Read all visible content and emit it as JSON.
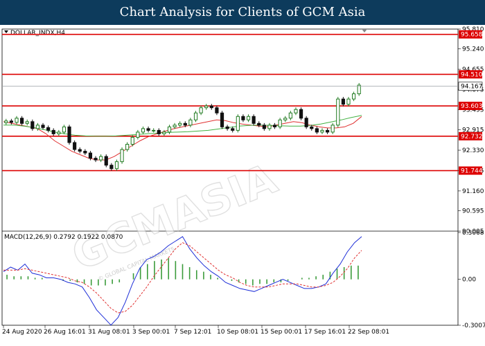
{
  "header": {
    "title": "Chart Analysis for Clients of GCM Asia"
  },
  "symbol_label": "DOLLAR_INDX,H4",
  "watermark": {
    "main": "GCMASIA",
    "sub": "© GLOBAL CAPITAL MARKETS"
  },
  "chart_data": [
    {
      "type": "candlestick",
      "title": "DOLLAR_INDX,H4",
      "ylim": [
        90.005,
        95.81
      ],
      "y_ticks": [
        95.81,
        95.24,
        94.655,
        94.075,
        93.495,
        92.915,
        92.33,
        91.745,
        91.16,
        90.595,
        90.005
      ],
      "current_price": 94.167,
      "support_resistance": [
        95.658,
        94.51,
        93.603,
        92.732,
        91.744
      ],
      "x_ticks": [
        "24 Aug 2020",
        "26 Aug 16:01",
        "31 Aug 08:01",
        "3 Sep 00:01",
        "7 Sep 12:01",
        "10 Sep 08:01",
        "15 Sep 00:01",
        "17 Sep 16:01",
        "22 Sep 08:01"
      ],
      "close_series": [
        93.17,
        93.13,
        93.25,
        93.1,
        93.15,
        92.95,
        93.05,
        92.98,
        92.9,
        92.8,
        92.85,
        93.0,
        92.55,
        92.35,
        92.3,
        92.25,
        92.1,
        92.05,
        92.15,
        91.9,
        91.8,
        92.0,
        92.35,
        92.5,
        92.7,
        92.85,
        92.95,
        92.9,
        92.9,
        92.8,
        92.85,
        93.0,
        93.05,
        93.1,
        93.05,
        93.2,
        93.4,
        93.55,
        93.6,
        93.55,
        93.4,
        93.0,
        92.95,
        92.9,
        93.3,
        93.2,
        93.3,
        93.1,
        93.05,
        92.95,
        93.05,
        93.0,
        93.2,
        93.25,
        93.4,
        93.5,
        93.25,
        93.0,
        92.95,
        92.85,
        92.9,
        92.85,
        93.05,
        93.8,
        93.65,
        93.8,
        93.95,
        94.2
      ],
      "ma_red": [
        93.15,
        93.1,
        93.05,
        93.0,
        92.95,
        92.8,
        92.6,
        92.45,
        92.3,
        92.2,
        92.1,
        92.05,
        92.05,
        92.15,
        92.3,
        92.45,
        92.6,
        92.72,
        92.8,
        92.88,
        92.95,
        93.0,
        93.05,
        93.1,
        93.15,
        93.2,
        93.18,
        93.12,
        93.08,
        93.05,
        93.02,
        93.0,
        93.05,
        93.1,
        93.15,
        93.12,
        93.05,
        93.0,
        92.97,
        92.97,
        93.0,
        93.1,
        93.3
      ],
      "ma_green": [
        93.05,
        93.05,
        93.02,
        92.98,
        92.92,
        92.85,
        92.8,
        92.76,
        92.74,
        92.73,
        92.73,
        92.74,
        92.76,
        92.78,
        92.8,
        92.82,
        92.84,
        92.85,
        92.86,
        92.88,
        92.9,
        92.94,
        92.98,
        93.02,
        93.04,
        93.05,
        93.04,
        93.03,
        93.02,
        93.02,
        93.04,
        93.08,
        93.14,
        93.2,
        93.27,
        93.33
      ]
    },
    {
      "type": "line",
      "title": "MACD(12,26,9) 0.2792 0.1922 0.0870",
      "ylim": [
        -0.3007,
        0.3068
      ],
      "y_ticks": [
        0.3068,
        0.0,
        -0.3007
      ],
      "series": [
        {
          "name": "MACD",
          "values": [
            0.05,
            0.08,
            0.06,
            0.1,
            0.04,
            0.03,
            0.01,
            0.01,
            0.0,
            -0.02,
            -0.03,
            -0.05,
            -0.12,
            -0.2,
            -0.25,
            -0.3,
            -0.25,
            -0.15,
            -0.03,
            0.07,
            0.13,
            0.15,
            0.18,
            0.22,
            0.25,
            0.28,
            0.2,
            0.14,
            0.09,
            0.05,
            0.02,
            -0.02,
            -0.04,
            -0.06,
            -0.07,
            -0.08,
            -0.06,
            -0.04,
            -0.02,
            0.0,
            -0.02,
            -0.04,
            -0.06,
            -0.06,
            -0.05,
            -0.03,
            0.04,
            0.1,
            0.18,
            0.24,
            0.28
          ]
        },
        {
          "name": "Signal",
          "values": [
            0.06,
            0.06,
            0.06,
            0.07,
            0.06,
            0.05,
            0.04,
            0.03,
            0.02,
            0.01,
            -0.01,
            -0.02,
            -0.05,
            -0.09,
            -0.14,
            -0.19,
            -0.22,
            -0.21,
            -0.17,
            -0.11,
            -0.05,
            0.02,
            0.08,
            0.14,
            0.2,
            0.24,
            0.22,
            0.18,
            0.14,
            0.1,
            0.06,
            0.03,
            0.01,
            -0.02,
            -0.04,
            -0.05,
            -0.05,
            -0.05,
            -0.04,
            -0.03,
            -0.03,
            -0.03,
            -0.04,
            -0.05,
            -0.05,
            -0.04,
            -0.02,
            0.02,
            0.07,
            0.14,
            0.19
          ]
        },
        {
          "name": "Histogram",
          "values": [
            0.03,
            0.02,
            0.02,
            0.02,
            0.01,
            0.01,
            0.0,
            0.0,
            -0.01,
            -0.01,
            -0.02,
            -0.03,
            -0.04,
            -0.04,
            -0.04,
            -0.03,
            -0.02,
            0.0,
            0.04,
            0.08,
            0.1,
            0.12,
            0.13,
            0.14,
            0.12,
            0.1,
            0.08,
            0.06,
            0.05,
            0.03,
            0.01,
            0.0,
            -0.01,
            -0.02,
            -0.03,
            -0.04,
            -0.03,
            -0.03,
            -0.02,
            -0.02,
            -0.01,
            0.0,
            0.01,
            0.01,
            0.02,
            0.03,
            0.05,
            0.07,
            0.08,
            0.09,
            0.09
          ]
        }
      ]
    }
  ],
  "colors": {
    "header_bg": "#0d3b5c",
    "bull": "#1f7a1f",
    "bear": "#111111",
    "ma_red": "#e03030",
    "ma_green": "#40b040",
    "level_line": "#dd0000",
    "label_bg": "#dd0000",
    "price_label_bg": "#ffffff",
    "macd_line": "#1d2ed8",
    "signal_line": "#e03030",
    "histogram": "#3a9b3a"
  }
}
